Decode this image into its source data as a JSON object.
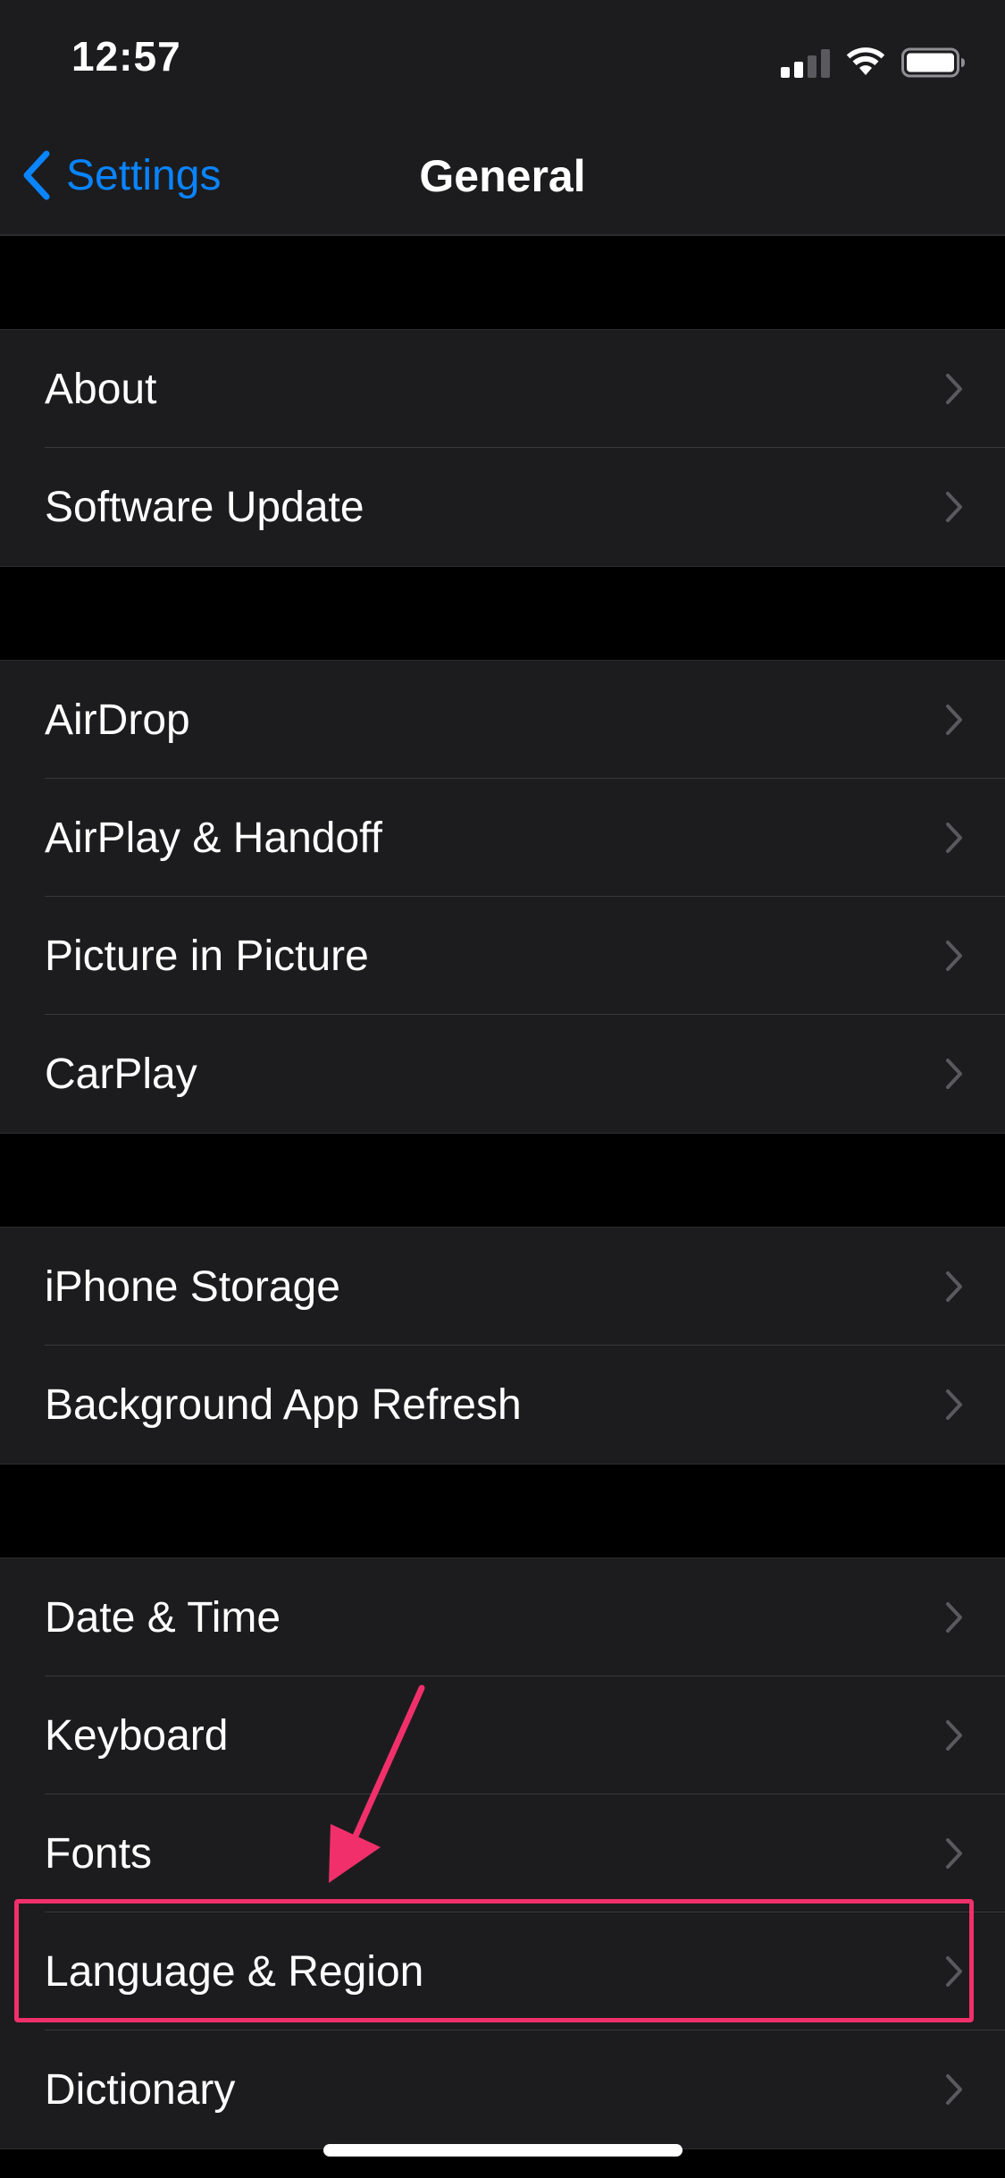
{
  "status_bar": {
    "time": "12:57",
    "icons": [
      "cellular-signal-icon",
      "wifi-icon",
      "battery-icon"
    ]
  },
  "nav": {
    "back_label": "Settings",
    "title": "General"
  },
  "groups": [
    {
      "items": [
        {
          "label": "About"
        },
        {
          "label": "Software Update"
        }
      ]
    },
    {
      "items": [
        {
          "label": "AirDrop"
        },
        {
          "label": "AirPlay & Handoff"
        },
        {
          "label": "Picture in Picture"
        },
        {
          "label": "CarPlay"
        }
      ]
    },
    {
      "items": [
        {
          "label": "iPhone Storage"
        },
        {
          "label": "Background App Refresh"
        }
      ]
    },
    {
      "items": [
        {
          "label": "Date & Time"
        },
        {
          "label": "Keyboard"
        },
        {
          "label": "Fonts"
        },
        {
          "label": "Language & Region"
        },
        {
          "label": "Dictionary"
        }
      ]
    }
  ],
  "annotation": {
    "highlighted_item": "Language & Region",
    "highlight_color": "#f1306b"
  },
  "colors": {
    "accent": "#0a84ff",
    "background": "#000000",
    "cell_background": "#1c1c1e",
    "separator": "#38383a",
    "chevron": "#5a5a5e"
  }
}
